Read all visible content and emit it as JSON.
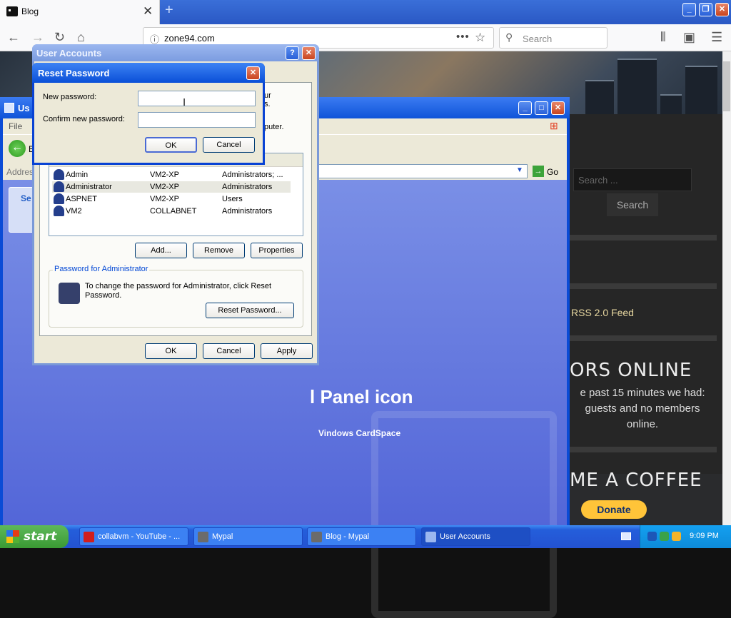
{
  "browser": {
    "tab_title": "Blog",
    "tab_close": "✕",
    "new_tab": "+",
    "url": "zone94.com",
    "search_placeholder": "Search",
    "window_buttons": [
      "_",
      "❐",
      "✕"
    ]
  },
  "website": {
    "sidebar_search_placeholder": "Search ...",
    "sidebar_search_button": "Search",
    "rss_link": "RSS 2.0 Feed",
    "visitors_heading": "ORS ONLINE",
    "visitors_text": "e past 15 minutes we had: guests and no members online.",
    "coffee_heading": "ME A COFFEE",
    "donate_button": "Donate"
  },
  "control_panel": {
    "title": "Us",
    "menu_file": "File",
    "back_label": "B",
    "address_label": "Addres",
    "go_label": "Go",
    "task_label": "Se",
    "big_text": "l Panel icon",
    "sub_text": "Vindows CardSpace"
  },
  "user_accounts": {
    "title": "User Accounts",
    "help": "?",
    "close": "✕",
    "fragment_top": "ur\ns.",
    "fragment_mid": "puter.",
    "users": [
      {
        "name": "Admin",
        "domain": "VM2-XP",
        "group": "Administrators; ..."
      },
      {
        "name": "Administrator",
        "domain": "VM2-XP",
        "group": "Administrators"
      },
      {
        "name": "ASPNET",
        "domain": "VM2-XP",
        "group": "Users"
      },
      {
        "name": "VM2",
        "domain": "COLLABNET",
        "group": "Administrators"
      }
    ],
    "btn_add": "Add...",
    "btn_remove": "Remove",
    "btn_properties": "Properties",
    "group_label": "Password for Administrator",
    "group_text": "To change the password for Administrator, click Reset Password.",
    "btn_reset": "Reset Password...",
    "btn_ok": "OK",
    "btn_cancel": "Cancel",
    "btn_apply": "Apply"
  },
  "reset_password": {
    "title": "Reset Password",
    "close": "✕",
    "new_password_label": "New password:",
    "confirm_label": "Confirm new password:",
    "new_password_value": "",
    "confirm_value": "",
    "btn_ok": "OK",
    "btn_cancel": "Cancel"
  },
  "taskbar": {
    "start": "start",
    "items": [
      {
        "label": "collabvm - YouTube - ...",
        "color": "#d21e1e"
      },
      {
        "label": "Mypal",
        "color": "#6b6b6b"
      },
      {
        "label": "Blog - Mypal",
        "color": "#6b6b6b"
      },
      {
        "label": "User Accounts",
        "color": "#9bb7ef"
      }
    ],
    "clock": "9:09 PM"
  }
}
